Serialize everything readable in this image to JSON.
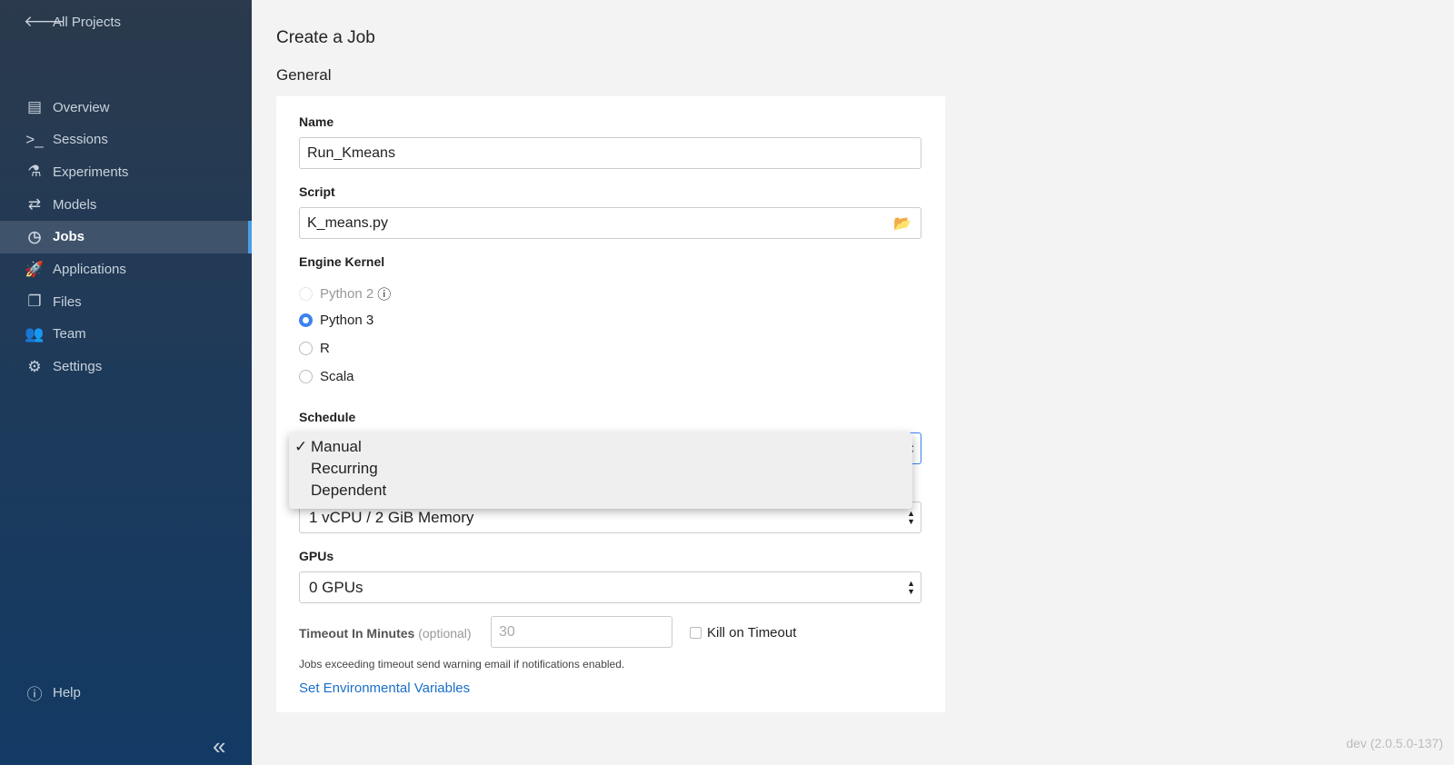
{
  "sidebar": {
    "back": "All Projects",
    "items": [
      {
        "label": "Overview",
        "icon": "overview-icon",
        "glyph": "▤"
      },
      {
        "label": "Sessions",
        "icon": "terminal-icon",
        "glyph": ">_"
      },
      {
        "label": "Experiments",
        "icon": "flask-icon",
        "glyph": "⚗"
      },
      {
        "label": "Models",
        "icon": "arrows-icon",
        "glyph": "⇄"
      },
      {
        "label": "Jobs",
        "icon": "clock-icon",
        "glyph": "◷"
      },
      {
        "label": "Applications",
        "icon": "rocket-icon",
        "glyph": "🚀"
      },
      {
        "label": "Files",
        "icon": "files-icon",
        "glyph": "❐"
      },
      {
        "label": "Team",
        "icon": "team-icon",
        "glyph": "👥"
      },
      {
        "label": "Settings",
        "icon": "gear-icon",
        "glyph": "⚙"
      }
    ],
    "help": "Help",
    "active": "Jobs"
  },
  "page": {
    "title": "Create a Job",
    "section": "General"
  },
  "form": {
    "name_label": "Name",
    "name_value": "Run_Kmeans",
    "script_label": "Script",
    "script_value": "K_means.py",
    "kernel_label": "Engine Kernel",
    "kernels": [
      "Python 2",
      "Python 3",
      "R",
      "Scala"
    ],
    "kernel_selected": "Python 3",
    "schedule_label": "Schedule",
    "schedule_options": [
      "Manual",
      "Recurring",
      "Dependent"
    ],
    "schedule_selected": "Manual",
    "profile_value": "1 vCPU / 2 GiB Memory",
    "gpus_label": "GPUs",
    "gpus_value": "0 GPUs",
    "timeout_label": "Timeout In Minutes",
    "timeout_optional": "(optional)",
    "timeout_placeholder": "30",
    "kill_label": "Kill on Timeout",
    "timeout_note": "Jobs exceeding timeout send warning email if notifications enabled.",
    "env_link": "Set Environmental Variables"
  },
  "version": "dev (2.0.5.0-137)",
  "colors": {
    "accent": "#3b82f0",
    "link": "#1a6fc9"
  }
}
